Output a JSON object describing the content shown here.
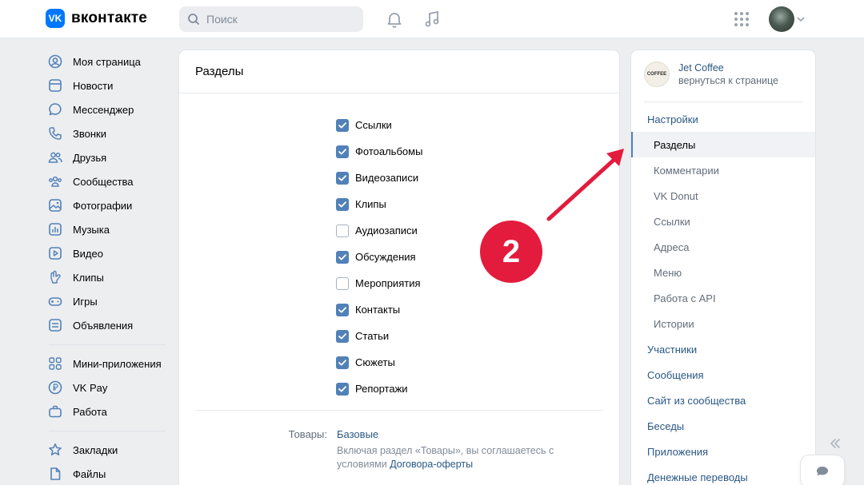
{
  "header": {
    "logo_mark": "VK",
    "logo_text": "вконтакте",
    "search_placeholder": "Поиск"
  },
  "leftnav": {
    "items": [
      {
        "label": "Моя страница",
        "icon": "user-circle-icon"
      },
      {
        "label": "Новости",
        "icon": "newsfeed-icon"
      },
      {
        "label": "Мессенджер",
        "icon": "message-icon"
      },
      {
        "label": "Звонки",
        "icon": "phone-icon"
      },
      {
        "label": "Друзья",
        "icon": "friends-icon"
      },
      {
        "label": "Сообщества",
        "icon": "communities-icon"
      },
      {
        "label": "Фотографии",
        "icon": "photo-icon"
      },
      {
        "label": "Музыка",
        "icon": "music-icon"
      },
      {
        "label": "Видео",
        "icon": "video-icon"
      },
      {
        "label": "Клипы",
        "icon": "clips-icon"
      },
      {
        "label": "Игры",
        "icon": "gamepad-icon"
      },
      {
        "label": "Объявления",
        "icon": "classifieds-icon"
      }
    ],
    "items2": [
      {
        "label": "Мини-приложения",
        "icon": "apps-grid-icon"
      },
      {
        "label": "VK Pay",
        "icon": "vkpay-icon"
      },
      {
        "label": "Работа",
        "icon": "briefcase-icon"
      }
    ],
    "items3": [
      {
        "label": "Закладки",
        "icon": "star-icon"
      },
      {
        "label": "Файлы",
        "icon": "file-icon"
      }
    ]
  },
  "main": {
    "title": "Разделы",
    "checkboxes": [
      {
        "label": "Ссылки",
        "checked": true
      },
      {
        "label": "Фотоальбомы",
        "checked": true
      },
      {
        "label": "Видеозаписи",
        "checked": true
      },
      {
        "label": "Клипы",
        "checked": true
      },
      {
        "label": "Аудиозаписи",
        "checked": false
      },
      {
        "label": "Обсуждения",
        "checked": true
      },
      {
        "label": "Мероприятия",
        "checked": false
      },
      {
        "label": "Контакты",
        "checked": true
      },
      {
        "label": "Статьи",
        "checked": true
      },
      {
        "label": "Сюжеты",
        "checked": true
      },
      {
        "label": "Репортажи",
        "checked": true
      }
    ],
    "goods": {
      "label": "Товары:",
      "value": "Базовые",
      "note_text": "Включая раздел «Товары», вы соглашаетесь с условиями ",
      "note_link": "Договора-оферты"
    }
  },
  "group": {
    "avatar_text": "COFFEE",
    "name": "Jet Coffee",
    "back": "вернуться к странице"
  },
  "rightmenu": [
    {
      "label": "Настройки",
      "type": "top"
    },
    {
      "label": "Разделы",
      "type": "active"
    },
    {
      "label": "Комментарии",
      "type": "sub"
    },
    {
      "label": "VK Donut",
      "type": "sub"
    },
    {
      "label": "Ссылки",
      "type": "sub"
    },
    {
      "label": "Адреса",
      "type": "sub"
    },
    {
      "label": "Меню",
      "type": "sub"
    },
    {
      "label": "Работа с API",
      "type": "sub"
    },
    {
      "label": "Истории",
      "type": "sub"
    },
    {
      "label": "Участники",
      "type": "top"
    },
    {
      "label": "Сообщения",
      "type": "top"
    },
    {
      "label": "Сайт из сообщества",
      "type": "top"
    },
    {
      "label": "Беседы",
      "type": "top"
    },
    {
      "label": "Приложения",
      "type": "top"
    },
    {
      "label": "Денежные переводы",
      "type": "top"
    }
  ],
  "annotation": {
    "badge": "2",
    "color": "#e31b3d"
  },
  "colors": {
    "accent": "#5181b8",
    "link": "#2a5885",
    "brand": "#0077ff"
  }
}
